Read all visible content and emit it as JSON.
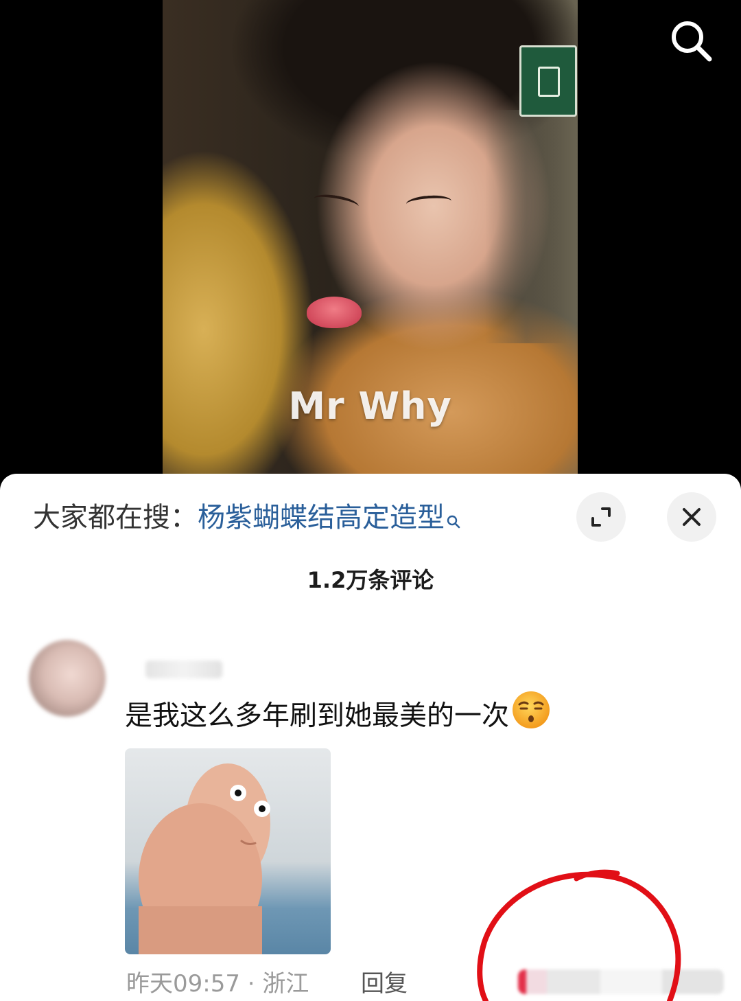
{
  "video": {
    "watermark": "Mr Why"
  },
  "hot_search": {
    "prefix": "大家都在搜：",
    "term": "杨紫蝴蝶结高定造型"
  },
  "comments_count": "1.2万条评论",
  "comment": {
    "text": "是我这么多年刷到她最美的一次",
    "emoji": "smirk-face-emoji",
    "time": "昨天09:57",
    "separator": " · ",
    "location": "浙江",
    "reply_label": "回复"
  },
  "icons": {
    "search": "search-icon",
    "expand": "expand-icon",
    "close": "close-icon"
  },
  "colors": {
    "link": "#2a5f9a",
    "annotation": "#e10f16",
    "like": "#e3304a"
  }
}
